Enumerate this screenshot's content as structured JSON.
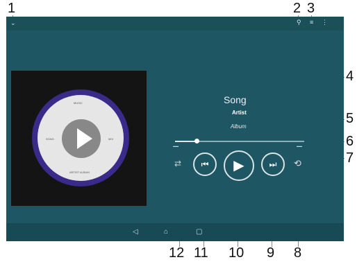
{
  "callouts": [
    "1",
    "2",
    "3",
    "4",
    "5",
    "6",
    "7",
    "8",
    "9",
    "10",
    "11",
    "12"
  ],
  "track": {
    "song": "Song",
    "artist": "Artist",
    "album": "Album"
  },
  "disc": {
    "top": "MUSIC",
    "left": "SONG",
    "right": "MIX",
    "bottom": "ARTIST ALBUM"
  },
  "playback": {
    "progress_fraction": 0.15
  },
  "icons": {
    "menu": "chevron-down-icon",
    "search": "search-icon",
    "visualizer": "equalizer-icon",
    "more": "more-vert-icon",
    "shuffle": "shuffle-icon",
    "previous": "skip-previous-icon",
    "play": "play-icon",
    "next": "skip-next-icon",
    "repeat": "repeat-icon",
    "back": "back-icon",
    "home": "home-icon",
    "recent": "recent-apps-icon"
  },
  "colors": {
    "screen_bg": "#1e5663",
    "art_bg": "#141414",
    "disc_ring": "#3a2a8a",
    "controls": "#d9e4e6"
  }
}
